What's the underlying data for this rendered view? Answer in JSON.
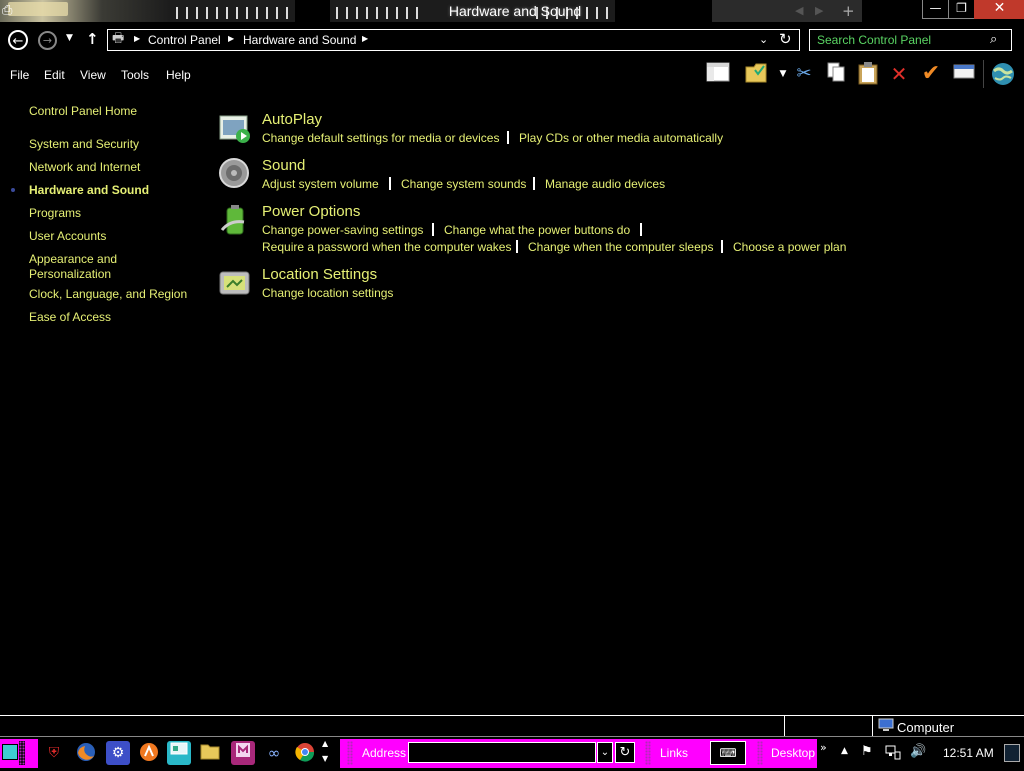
{
  "window": {
    "title": "Hardware and Sound",
    "controls": {
      "minimize": "—",
      "maximize": "❐",
      "close": "✕"
    }
  },
  "addressbar": {
    "breadcrumbs": [
      "Control Panel",
      "Hardware and Sound"
    ],
    "search_placeholder": "Search Control Panel"
  },
  "menu": [
    "File",
    "Edit",
    "View",
    "Tools",
    "Help"
  ],
  "toolbar": {
    "icons": [
      "layout-icon",
      "folder-options-icon",
      "cut-icon",
      "copy-icon",
      "paste-icon",
      "delete-icon",
      "check-icon",
      "properties-icon",
      "globe-icon"
    ]
  },
  "sidebar": {
    "home": "Control Panel Home",
    "items": [
      {
        "label": "System and Security",
        "current": false
      },
      {
        "label": "Network and Internet",
        "current": false
      },
      {
        "label": "Hardware and Sound",
        "current": true
      },
      {
        "label": "Programs",
        "current": false
      },
      {
        "label": "User Accounts",
        "current": false
      },
      {
        "label": "Appearance and\nPersonalization",
        "current": false
      },
      {
        "label": "Clock, Language, and Region",
        "current": false
      },
      {
        "label": "Ease of Access",
        "current": false
      }
    ]
  },
  "categories": [
    {
      "title": "AutoPlay",
      "icon": "autoplay-icon",
      "links": [
        "Change default settings for media or devices",
        "Play CDs or other media automatically"
      ]
    },
    {
      "title": "Sound",
      "icon": "speaker-icon",
      "links": [
        "Adjust system volume",
        "Change system sounds",
        "Manage audio devices"
      ]
    },
    {
      "title": "Power Options",
      "icon": "battery-icon",
      "links": [
        "Change power-saving settings",
        "Change what the power buttons do",
        "Require a password when the computer wakes",
        "Change when the computer sleeps",
        "Choose a power plan"
      ]
    },
    {
      "title": "Location Settings",
      "icon": "location-icon",
      "links": [
        "Change location settings"
      ]
    }
  ],
  "statusbar": {
    "location": "Computer"
  },
  "taskbar": {
    "address_label": "Address",
    "links_label": "Links",
    "desktop_label": "Desktop",
    "chevrons": "»",
    "clock": "12:51 AM",
    "apps": [
      "antivirus-icon",
      "firefox-icon",
      "settings-icon",
      "avast-icon",
      "control-panel-icon",
      "explorer-icon",
      "media-icon",
      "binoculars-icon",
      "chrome-icon"
    ]
  },
  "colors": {
    "link": "#e6f075",
    "search_text": "#5ad463",
    "taskbar_accent": "#ff00ff",
    "close_button": "#c0392b",
    "background": "#000000"
  }
}
